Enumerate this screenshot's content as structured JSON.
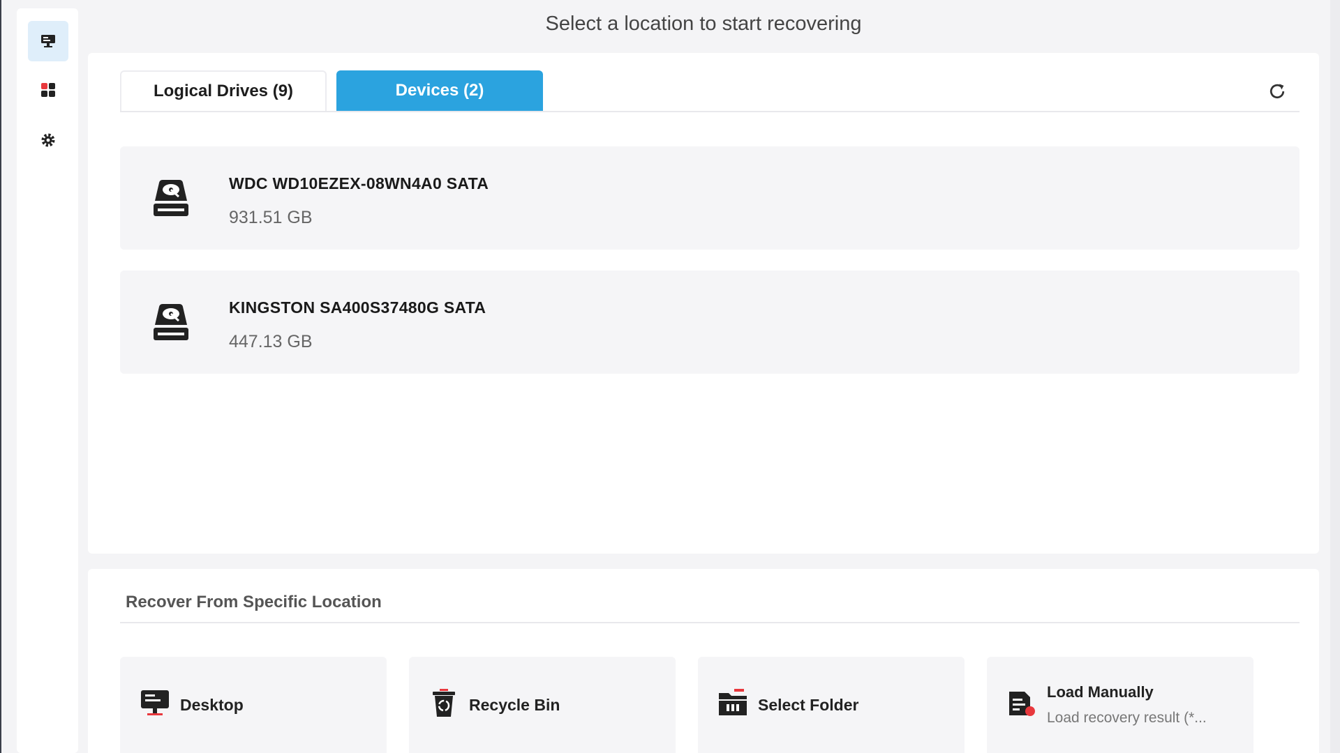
{
  "header": {
    "title": "Select a location to start recovering"
  },
  "sidebar": {
    "items": [
      {
        "icon": "computer-icon",
        "active": true
      },
      {
        "icon": "apps-grid-icon",
        "active": false
      },
      {
        "icon": "gear-icon",
        "active": false
      }
    ]
  },
  "tabs": [
    {
      "label": "Logical Drives (9)",
      "active": false
    },
    {
      "label": "Devices (2)",
      "active": true
    }
  ],
  "devices": [
    {
      "name": "WDC WD10EZEX-08WN4A0 SATA",
      "size": "931.51 GB",
      "icon": "hard-drive-icon"
    },
    {
      "name": "KINGSTON SA400S37480G SATA",
      "size": "447.13 GB",
      "icon": "hard-drive-icon"
    }
  ],
  "specific": {
    "title": "Recover From Specific Location",
    "locations": [
      {
        "label": "Desktop",
        "icon": "desktop-icon"
      },
      {
        "label": "Recycle Bin",
        "icon": "recycle-bin-icon"
      },
      {
        "label": "Select Folder",
        "icon": "folder-icon"
      },
      {
        "label": "Load Manually",
        "sub": "Load recovery result (*...",
        "icon": "load-file-icon"
      }
    ]
  },
  "colors": {
    "accent": "#2ba3df",
    "background": "#f4f4f6",
    "card": "#f5f5f7",
    "alert": "#e8383d"
  }
}
